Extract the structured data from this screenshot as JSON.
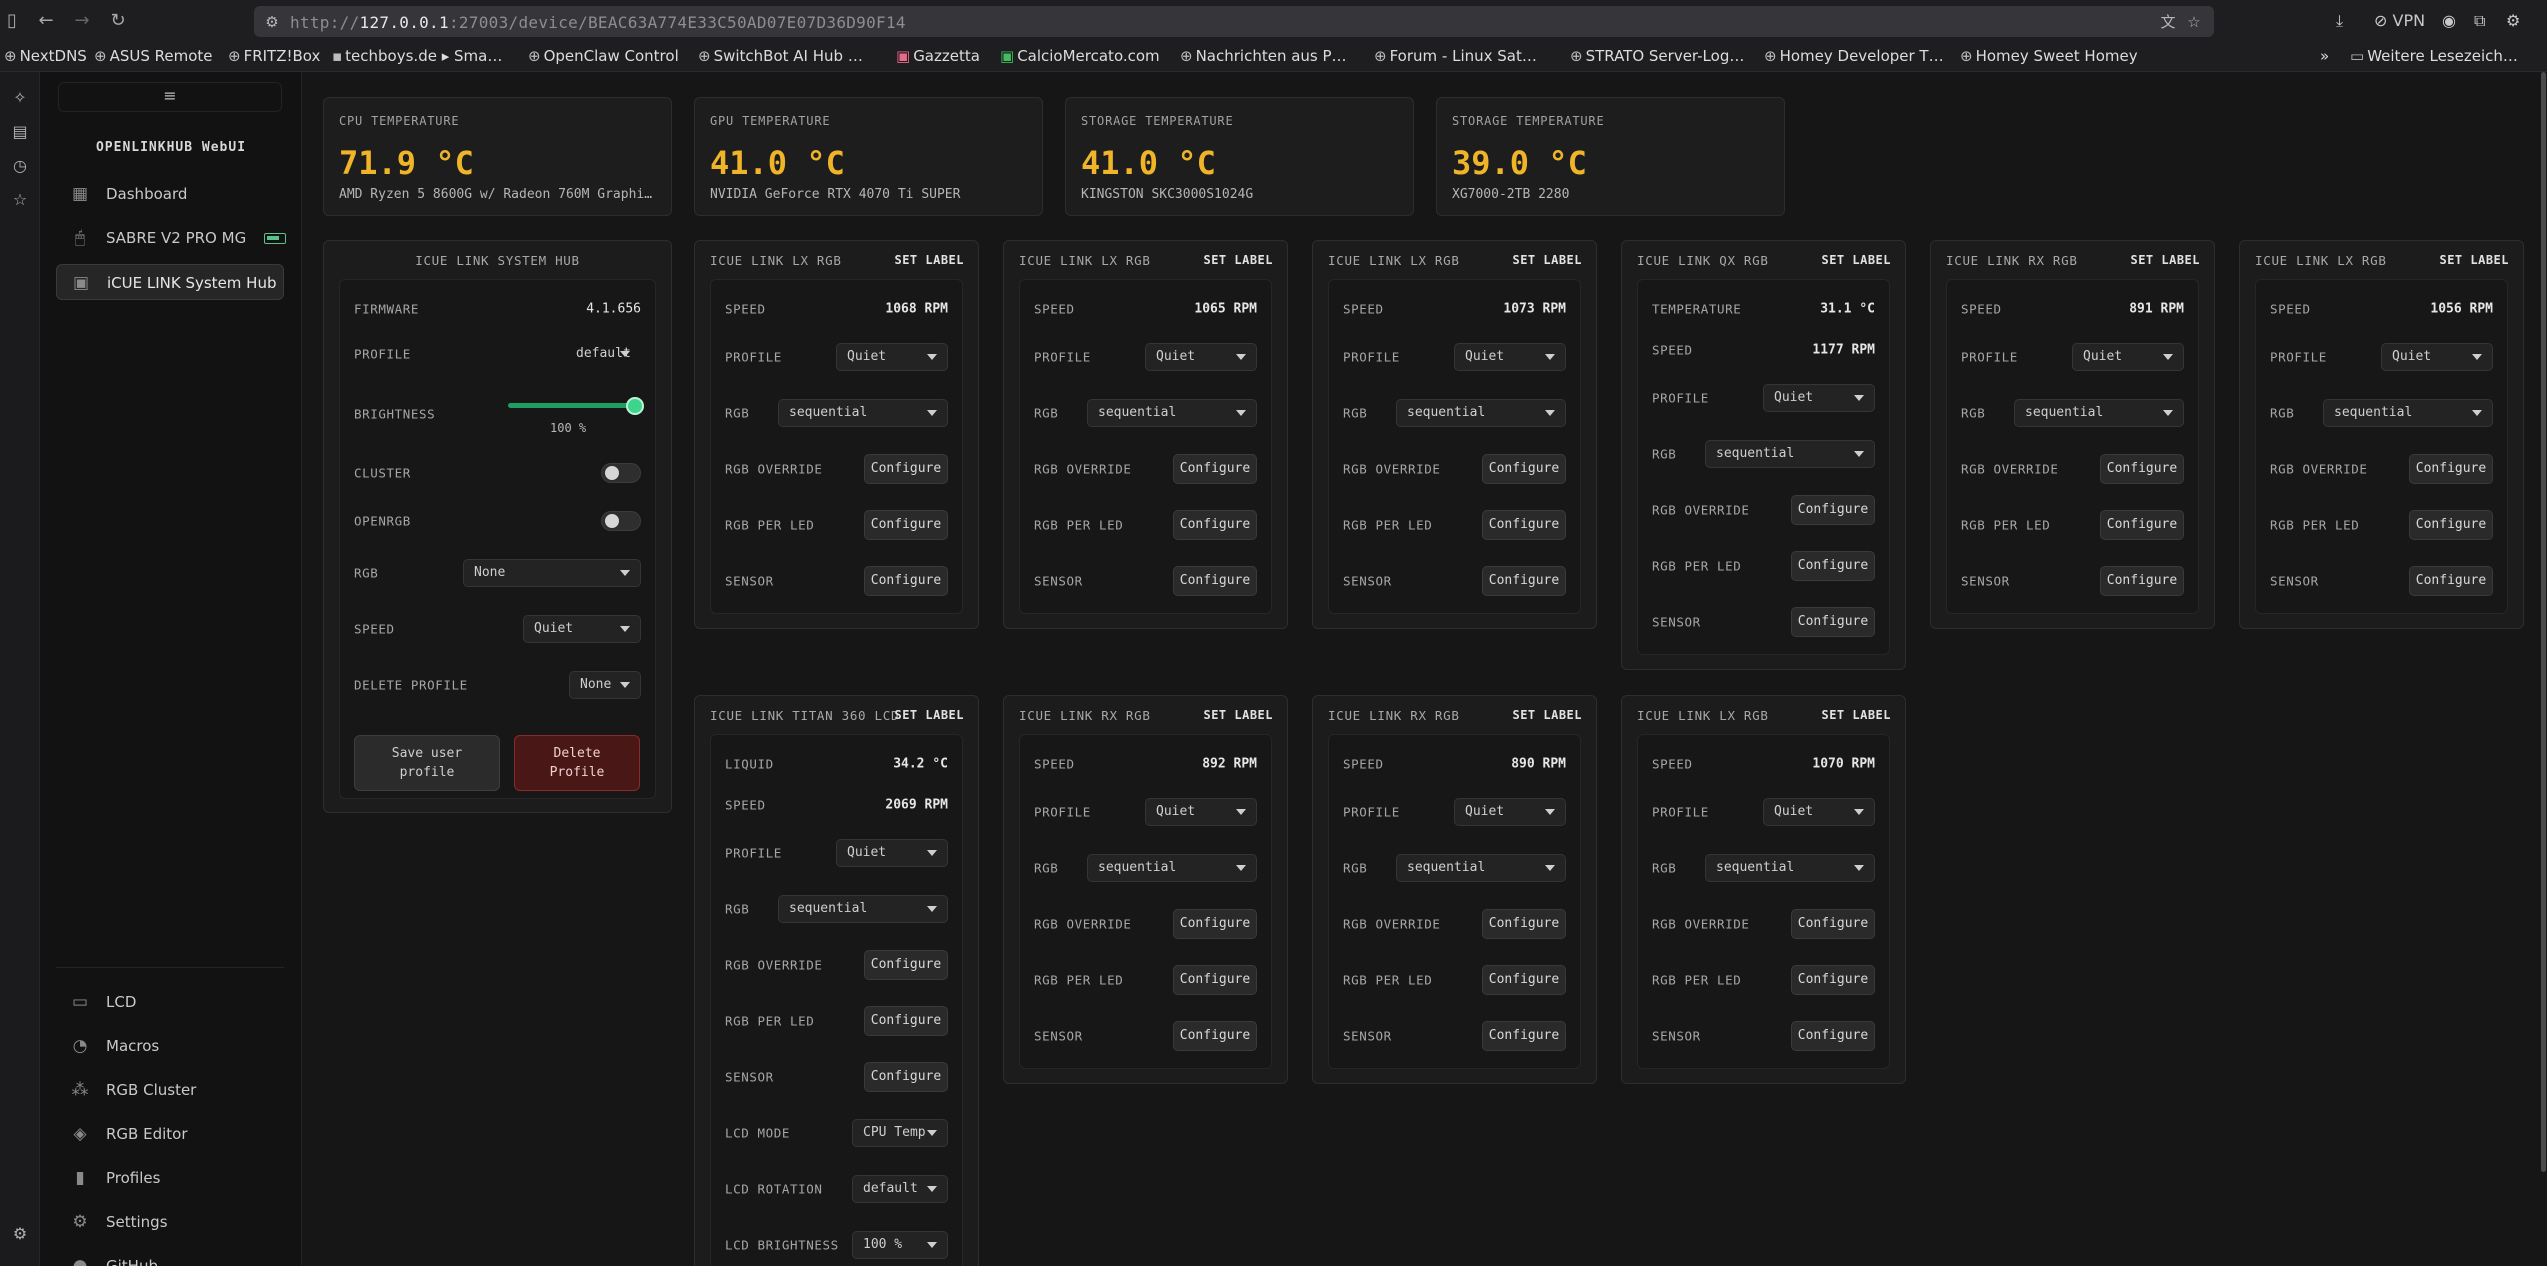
{
  "browser": {
    "url_prefix": "http://",
    "url_host": "127.0.0.1",
    "url_rest": ":27003/device/BEAC63A774E33C50AD07E07D36D90F14",
    "vpn_label": "VPN",
    "bookmarks": [
      "NextDNS",
      "ASUS Remote",
      "FRITZ!Box",
      "techboys.de ▸ Sma…",
      "OpenClaw Control",
      "SwitchBot AI Hub …",
      "Gazzetta",
      "CalcioMercato.com",
      "Nachrichten aus P…",
      "Forum - Linux Sat…",
      "STRATO Server-Log…",
      "Homey Developer T…",
      "Homey Sweet Homey"
    ],
    "more_bookmarks": "Weitere Lesezeich…"
  },
  "sidebar": {
    "menu_icon": "≡",
    "brand": "OPENLINKHUB WebUI",
    "top_items": [
      {
        "label": "Dashboard",
        "icon": "dashboard-icon"
      },
      {
        "label": "SABRE V2 PRO MG",
        "icon": "mouse-icon"
      },
      {
        "label": "iCUE LINK System Hub",
        "icon": "chip-icon"
      }
    ],
    "bottom_items": [
      {
        "label": "LCD",
        "icon": "monitor-icon"
      },
      {
        "label": "Macros",
        "icon": "macro-icon"
      },
      {
        "label": "RGB Cluster",
        "icon": "cluster-icon"
      },
      {
        "label": "RGB Editor",
        "icon": "palette-icon"
      },
      {
        "label": "Profiles",
        "icon": "profile-icon"
      },
      {
        "label": "Settings",
        "icon": "gear-icon"
      },
      {
        "label": "GitHub",
        "icon": "github-icon"
      }
    ]
  },
  "temps": [
    {
      "label": "CPU TEMPERATURE",
      "value": "71.9 °C",
      "sub": "AMD Ryzen 5 8600G w/ Radeon 760M Graphics"
    },
    {
      "label": "GPU TEMPERATURE",
      "value": "41.0 °C",
      "sub": "NVIDIA GeForce RTX 4070 Ti SUPER"
    },
    {
      "label": "STORAGE TEMPERATURE",
      "value": "41.0 °C",
      "sub": "KINGSTON SKC3000S1024G"
    },
    {
      "label": "STORAGE TEMPERATURE",
      "value": "39.0 °C",
      "sub": "XG7000-2TB 2280"
    }
  ],
  "hub": {
    "title": "ICUE LINK SYSTEM HUB",
    "firmware_label": "FIRMWARE",
    "firmware_value": "4.1.656",
    "profile_label": "PROFILE",
    "profile_value": "default",
    "brightness_label": "BRIGHTNESS",
    "brightness_value": "100 %",
    "cluster_label": "CLUSTER",
    "openrgb_label": "OPENRGB",
    "rgb_label": "RGB",
    "rgb_value": "None",
    "speed_label": "SPEED",
    "speed_value": "Quiet",
    "delete_profile_label": "DELETE PROFILE",
    "delete_profile_value": "None",
    "save_button": "Save user profile",
    "delete_button": "Delete Profile"
  },
  "common": {
    "set_label": "SET LABEL",
    "speed": "SPEED",
    "profile": "PROFILE",
    "rgb": "RGB",
    "rgb_override": "RGB OVERRIDE",
    "rgb_per_led": "RGB PER LED",
    "sensor": "SENSOR",
    "configure": "Configure",
    "temperature": "TEMPERATURE",
    "liquid": "LIQUID",
    "lcd_mode": "LCD MODE",
    "lcd_rotation": "LCD ROTATION",
    "lcd_brightness": "LCD BRIGHTNESS"
  },
  "devices": [
    {
      "title": "ICUE LINK LX RGB",
      "speed": "1068 RPM",
      "profile": "Quiet",
      "rgb": "sequential"
    },
    {
      "title": "ICUE LINK LX RGB",
      "speed": "1065 RPM",
      "profile": "Quiet",
      "rgb": "sequential"
    },
    {
      "title": "ICUE LINK LX RGB",
      "speed": "1073 RPM",
      "profile": "Quiet",
      "rgb": "sequential"
    },
    {
      "title": "ICUE LINK QX RGB",
      "temperature": "31.1 °C",
      "speed": "1177 RPM",
      "profile": "Quiet",
      "rgb": "sequential"
    },
    {
      "title": "ICUE LINK RX RGB",
      "speed": "891 RPM",
      "profile": "Quiet",
      "rgb": "sequential"
    },
    {
      "title": "ICUE LINK LX RGB",
      "speed": "1056 RPM",
      "profile": "Quiet",
      "rgb": "sequential"
    },
    {
      "title": "ICUE LINK TITAN 360 LCD",
      "liquid": "34.2 °C",
      "speed": "2069 RPM",
      "profile": "Quiet",
      "rgb": "sequential",
      "lcd_mode": "CPU Temp",
      "lcd_rotation": "default",
      "lcd_brightness": "100 %"
    },
    {
      "title": "ICUE LINK RX RGB",
      "speed": "892 RPM",
      "profile": "Quiet",
      "rgb": "sequential"
    },
    {
      "title": "ICUE LINK RX RGB",
      "speed": "890 RPM",
      "profile": "Quiet",
      "rgb": "sequential"
    },
    {
      "title": "ICUE LINK LX RGB",
      "speed": "1070 RPM",
      "profile": "Quiet",
      "rgb": "sequential"
    }
  ],
  "colors": {
    "accent": "#f0b429",
    "green": "#3fd48c",
    "danger": "#8a2b2b"
  }
}
